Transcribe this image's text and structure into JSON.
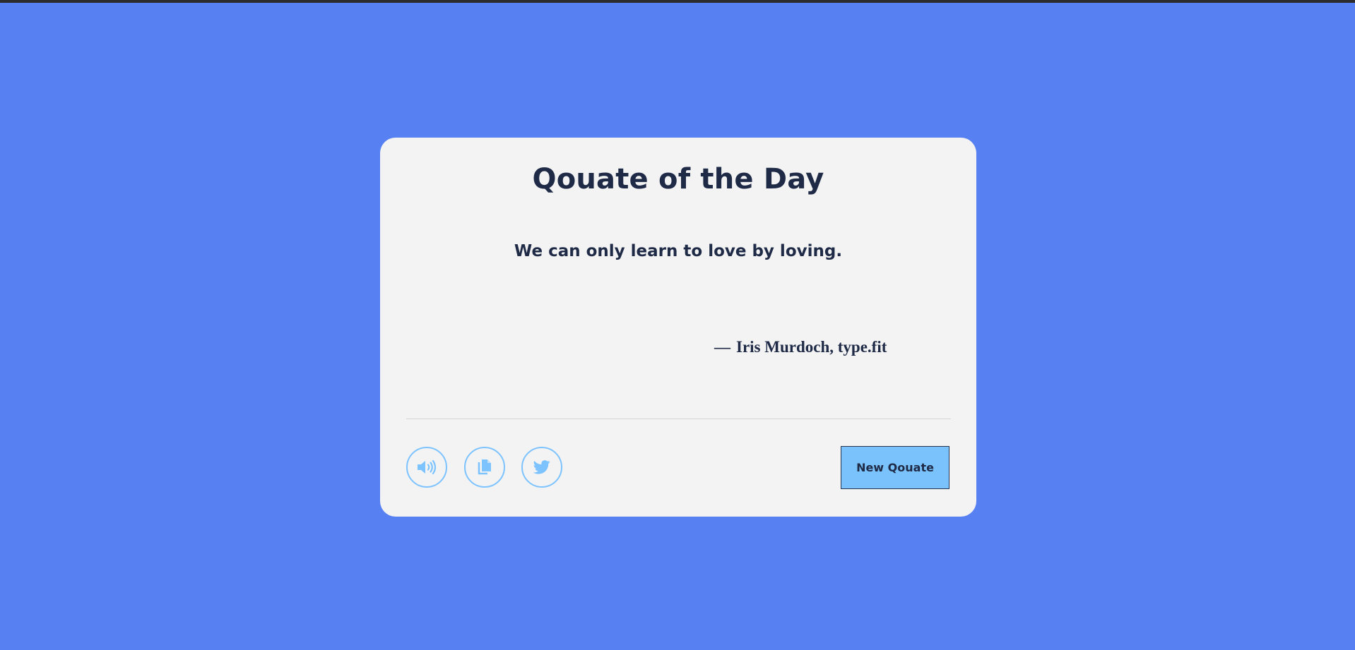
{
  "card": {
    "title": "Qouate of the Day",
    "quote": "We can only learn to love by loving.",
    "author_dash": "—",
    "author": "Iris Murdoch, type.fit"
  },
  "actions": {
    "speak_icon": "speaker-icon",
    "copy_icon": "copy-icon",
    "tweet_icon": "twitter-icon",
    "new_quote_label": "New Qouate"
  },
  "colors": {
    "background": "#5780f2",
    "card": "#f3f3f3",
    "text": "#1e2a46",
    "accent": "#7ac2fb",
    "icon_outline": "#7cc3ff"
  }
}
